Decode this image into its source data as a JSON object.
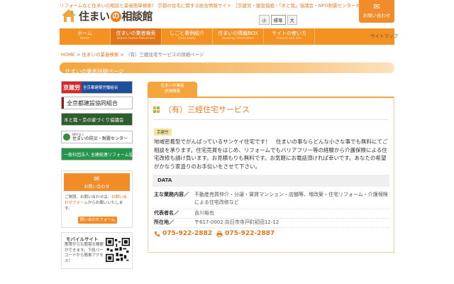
{
  "header": {
    "tagline": "リフォームなど住まいの相談と業者簡単検索！ 京都の住宅に関する総合情報サイト ［京建労・建設協組・「木と我」協議会・NPO耐震センター共同運営］",
    "logo_prefix": "住まい",
    "logo_mid": "の",
    "logo_suffix": "相談館",
    "font_size_label": "",
    "font_sizes": [
      "小",
      "標準",
      "大"
    ],
    "contact_label": "お問い合わせ",
    "sitemap_label": "サイトマップ"
  },
  "nav": [
    {
      "label": "ホーム",
      "en": "Home"
    },
    {
      "label": "住まいの業者検索",
      "en": "Search Home Reformers"
    },
    {
      "label": "しごと事例紹介",
      "en": "Case study"
    },
    {
      "label": "住まいの情報BOX",
      "en": "Housing information"
    },
    {
      "label": "サイトの使い方",
      "en": "How to use site"
    }
  ],
  "breadcrumb": {
    "home": "HOME",
    "sep": ">",
    "search": "住まいの業者検索",
    "current": "（有）三經住宅サービスの詳細ページ"
  },
  "section_title": "住まいの業者詳細ページ",
  "sidebar": {
    "banners": [
      {
        "main": "京建労",
        "sub": "全京都建築労働組合"
      },
      {
        "main": "全京都建設協同組合"
      },
      {
        "main": "木と我・京の家づくり協議会"
      },
      {
        "small": "NPO法人",
        "main": "住まいの防災・耐震センター"
      },
      {
        "main": "一般社団法人 全建総連リフォーム協会"
      }
    ],
    "contact": {
      "head": "お問い合わせ",
      "desc_1": "ご質問、お問い合わせは、",
      "desc_link": "お問い合わせフォーム",
      "desc_2": "からお願いいたします。",
      "button": "問い合わせフォーム"
    },
    "mobile": {
      "title": "モバイルサイト",
      "text": "携帯からも簡易な検索ができます。下段バーコードから簡単アクセス！"
    }
  },
  "main": {
    "tab_line1": "住まいの業者",
    "tab_line2": "詳細情報",
    "company_name": "（有）三經住宅サービス",
    "badge": "京建労",
    "intro": "地域密着型でがんばっているサンケイ住宅です！　住まいの事ならどんな小さな事でも無料にてご相談を承ります。住宅売買をはじめ、リフォームでもバリアフリー等の経験から介護保険による住宅改修も請け負います。お見積もりも無料です。お気軽にお電話頂ければ幸いです。あなたの希望がかなう家造りのお手伝いをさせて下さい。",
    "data_heading": "DATA",
    "fields": [
      {
        "label": "主な業務内容／",
        "value": "不動産売買仲介・分譲・賃貸マンション・店舗等、増改築・住宅リフォーム・介護保険による住宅改修など"
      },
      {
        "label": "代表者名／",
        "value": "吉川裕也"
      },
      {
        "label": "所在地／",
        "value": "〒617-0002 向日市寺戸町初田12-12"
      }
    ],
    "phone": "075-922-2882",
    "fax": "075-922-2887"
  },
  "colors": {
    "accent": "#f39223",
    "title_orange": "#e67e22",
    "green": "#8bc34a"
  }
}
